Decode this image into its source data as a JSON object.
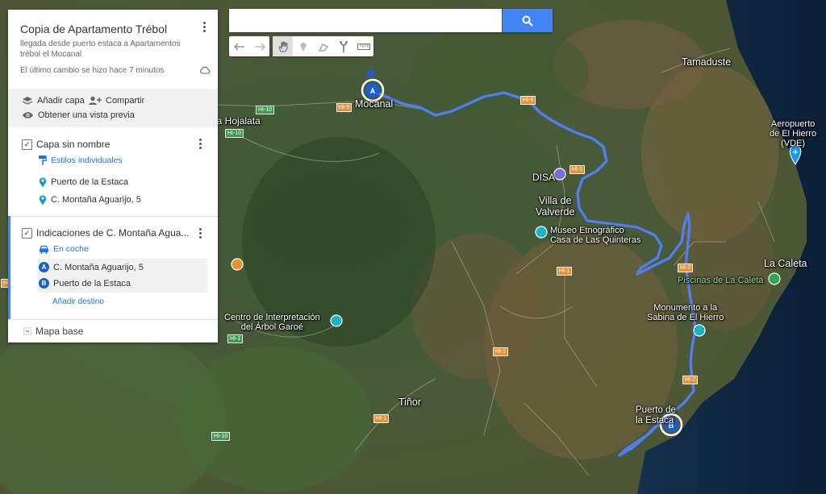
{
  "search": {
    "value": "",
    "placeholder": ""
  },
  "panel": {
    "title": "Copia de Apartamento Trébol",
    "description": "llegada desde puerto estaca a Apartamentos trébol el Mocanal",
    "last_change": "El último cambio se hizo hace 7 minutos",
    "add_layer": "Añadir capa",
    "share": "Compartir",
    "preview": "Obtener una vista previa",
    "layer1": {
      "name": "Capa sin nombre",
      "style": "Estilos individuales",
      "items": [
        "Puerto de la Estaca",
        "C. Montaña Aguarijo, 5"
      ]
    },
    "layer2": {
      "name": "Indicaciones de C. Montaña Agua...",
      "mode": "En coche",
      "stops": [
        {
          "letter": "A",
          "label": "C. Montaña Aguarijo, 5"
        },
        {
          "letter": "B",
          "label": "Puerto de la Estaca"
        }
      ],
      "add_destination": "Añadir destino"
    },
    "base_map": "Mapa base"
  },
  "map": {
    "places": {
      "mocanal": "Mocanal",
      "hojalata": "La Hojalata",
      "tamaduste": "Tamaduste",
      "aeropuerto": "Aeropuerto\nde El Hierro\n(VDE)",
      "disa": "DISA",
      "villa": "Villa de\nValverde",
      "museo": "Museo Etnográfico\nCasa de Las Quinteras",
      "caleta": "La Caleta",
      "piscinas": "Piscinas de La Caleta",
      "monumento": "Monumento a la\nSabina de El Hierro",
      "centro": "Centro de Interpretación\ndel Árbol Garoé",
      "tinor": "Tiñor",
      "puerto": "Puerto de\nla Estaca"
    },
    "roads": [
      "HI-10",
      "HI-5",
      "HI-5",
      "HI-1",
      "HI-10",
      "HI-1",
      "HI-1",
      "HI-1",
      "HI-1",
      "HI-10",
      "HI-1",
      "HI-2",
      "HI-2"
    ],
    "markers": {
      "a": "A",
      "b": "B"
    }
  }
}
